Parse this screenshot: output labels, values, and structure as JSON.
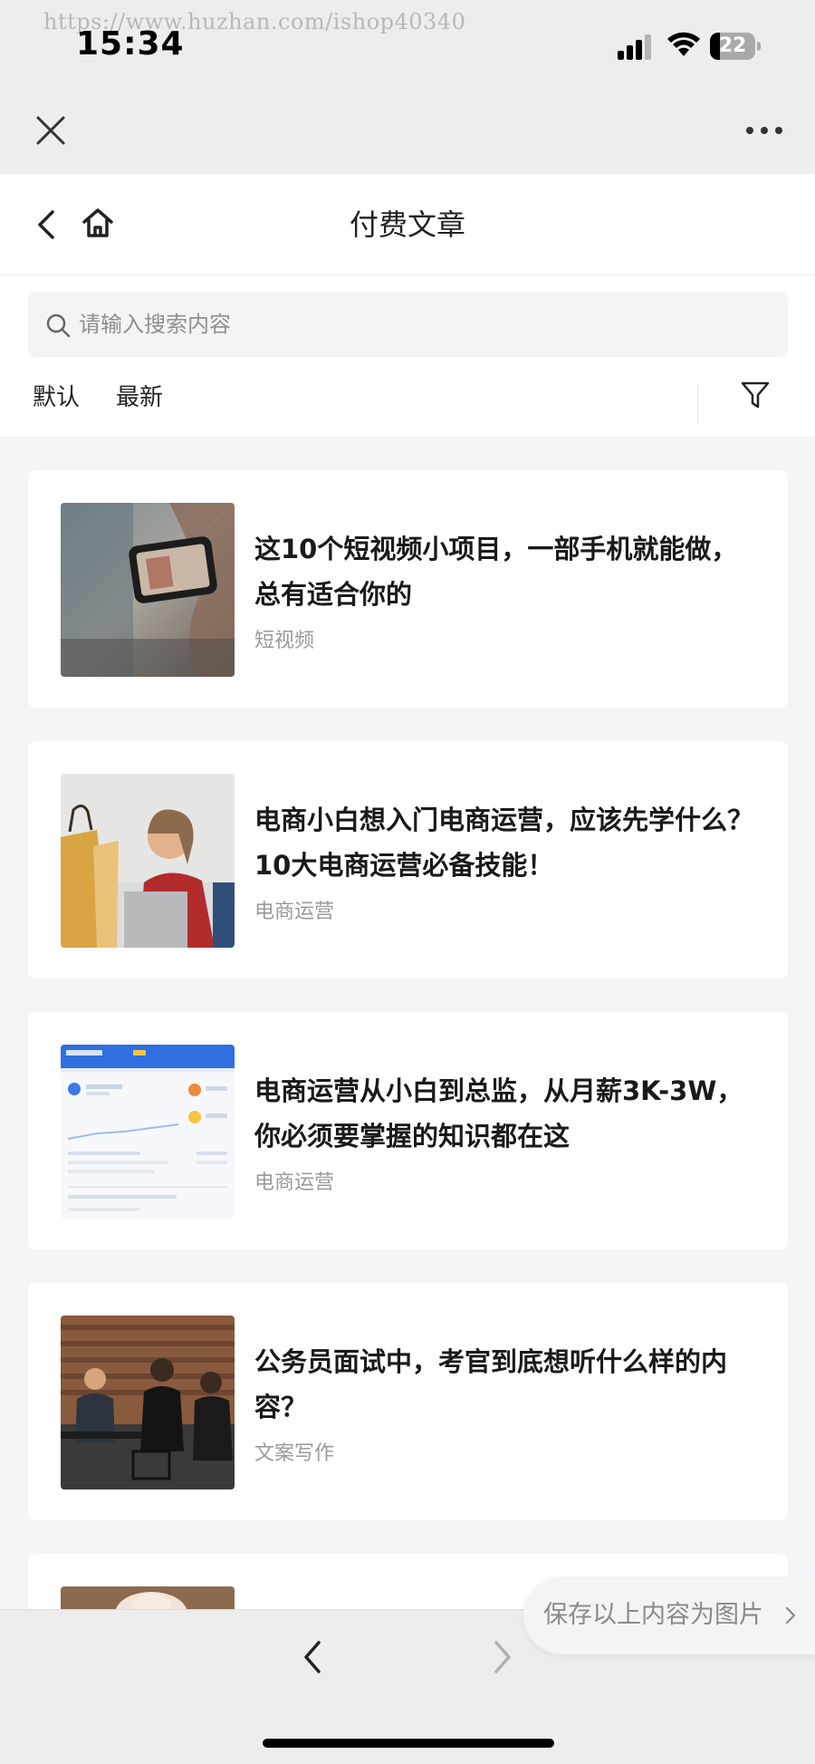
{
  "status_bar": {
    "watermark": "https://www.huzhan.com/ishop40340",
    "time": "15:34",
    "battery_level": "22",
    "battery_fraction": 0.22
  },
  "mini_program_bar": {
    "close_icon": "close-icon",
    "more_icon": "more-icon"
  },
  "nav": {
    "title": "付费文章",
    "back_icon": "back-icon",
    "home_icon": "home-icon"
  },
  "search": {
    "placeholder": "请输入搜索内容",
    "value": ""
  },
  "sort": {
    "tabs": [
      {
        "label": "默认"
      },
      {
        "label": "最新"
      }
    ],
    "filter_icon": "filter-icon"
  },
  "articles": [
    {
      "title": "这10个短视频小项目，一部手机就能做，总有适合你的",
      "tag": "短视频"
    },
    {
      "title": "电商小白想入门电商运营，应该先学什么？10大电商运营必备技能！",
      "tag": "电商运营"
    },
    {
      "title": "电商运营从小白到总监，从月薪3K-3W，你必须要掌握的知识都在这",
      "tag": "电商运营"
    },
    {
      "title": "公务员面试中，考官到底想听什么样的内容？",
      "tag": "文案写作"
    }
  ],
  "save_button": {
    "label": "保存以上内容为图片"
  },
  "bottom_nav": {
    "prev_icon": "chevron-left-icon",
    "next_icon": "chevron-right-icon"
  },
  "colors": {
    "background": "#f5f5f7",
    "card": "#ffffff",
    "bar": "#ededed",
    "title_text": "#1a1a1a",
    "tag_text": "#9a9a9a"
  }
}
